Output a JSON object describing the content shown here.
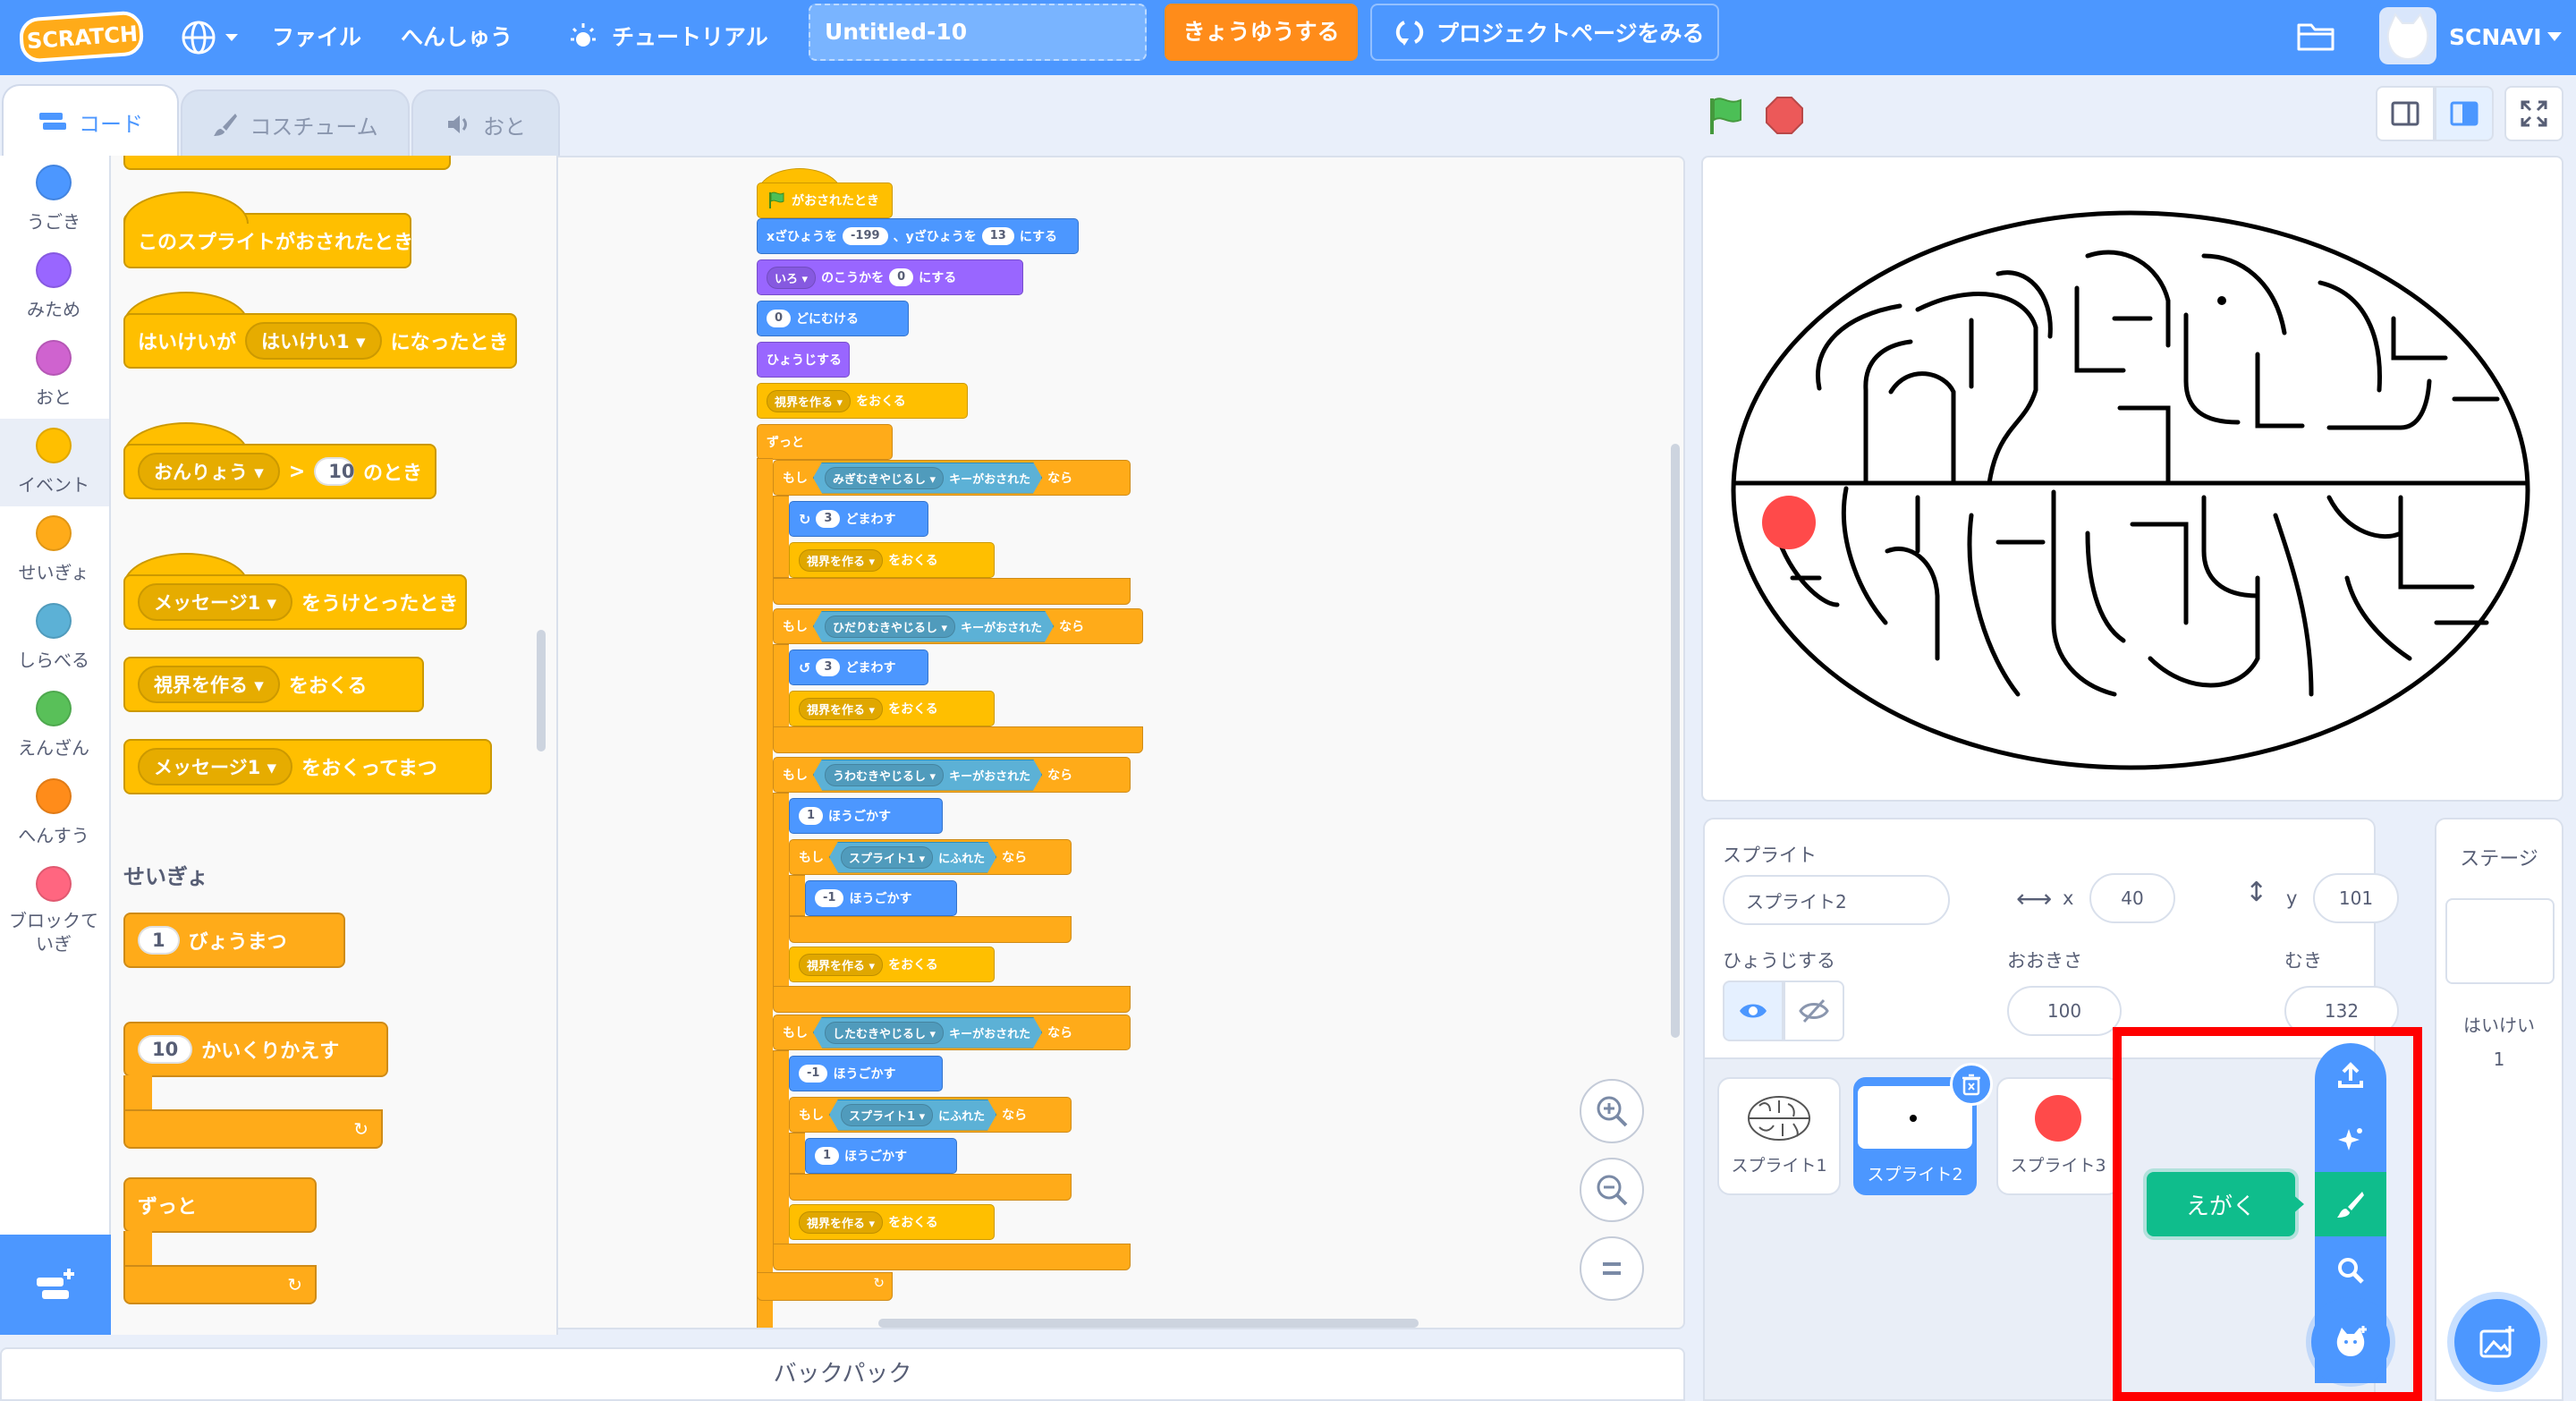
{
  "menu": {
    "logo": "SCRATCH",
    "file": "ファイル",
    "edit": "へんしゅう",
    "tutorial": "チュートリアル",
    "project_title": "Untitled-10",
    "share": "きょうゆうする",
    "see_project_page": "プロジェクトページをみる",
    "username": "SCNAVI"
  },
  "tabs": {
    "code": "コード",
    "costume": "コスチューム",
    "sound": "おと"
  },
  "categories": [
    {
      "label": "うごき",
      "color": "#4c97ff"
    },
    {
      "label": "みため",
      "color": "#9966ff"
    },
    {
      "label": "おと",
      "color": "#cf63cf"
    },
    {
      "label": "イベント",
      "color": "#ffbf00"
    },
    {
      "label": "せいぎょ",
      "color": "#ffab19"
    },
    {
      "label": "しらべる",
      "color": "#5cb1d6"
    },
    {
      "label": "えんざん",
      "color": "#59c059"
    },
    {
      "label": "へんすう",
      "color": "#ff8c1a"
    },
    {
      "label": "ブロックていぎ",
      "color": "#ff6680"
    }
  ],
  "palette": {
    "when_sprite_clicked": "このスプライトがおされたとき",
    "when_backdrop_a": "はいけいが",
    "backdrop_name": "はいけい1",
    "when_backdrop_b": "になったとき",
    "loudness": "おんりょう",
    "gt": ">",
    "loudness_value": "10",
    "when_gt_end": "のとき",
    "message1": "メッセージ1",
    "when_receive": "をうけとったとき",
    "view_make": "視界を作る",
    "broadcast": "をおくる",
    "broadcast_wait": "をおくってまつ",
    "control_heading": "せいぎょ",
    "wait_value": "1",
    "wait_label": "びょうまつ",
    "repeat_value": "10",
    "repeat_label": "かいくりかえす",
    "forever_label": "ずっと"
  },
  "script": {
    "flag_clicked": "がおされたとき",
    "goto_x_label": "xざひょうを",
    "goto_x": "-199",
    "goto_y_label": "、yざひょうを",
    "goto_y": "13",
    "goto_suffix": "にする",
    "effect_name": "いろ",
    "effect_label": "のこうかを",
    "effect_value": "0",
    "effect_suffix": "にする",
    "direction_value": "0",
    "direction_label": "どにむける",
    "show": "ひょうじする",
    "view_make": "視界を作る",
    "send": "をおくる",
    "forever": "ずっと",
    "if": "もし",
    "then": "なら",
    "key_pressed": "キーがおされた",
    "key_right": "みぎむきやじるし",
    "key_left": "ひだりむきやじるし",
    "key_up": "うわむきやじるし",
    "key_down": "したむきやじるし",
    "turn_value": "3",
    "turn_label": "どまわす",
    "move_label": "ほうごかす",
    "move_1": "1",
    "move_neg1": "-1",
    "touching_target": "スプライト1",
    "touching_label": "にふれた"
  },
  "backpack": "バックパック",
  "sprite_info": {
    "sprite_label": "スプライト",
    "sprite_name": "スプライト2",
    "x_label": "x",
    "x": "40",
    "y_label": "y",
    "y": "101",
    "show_label": "ひょうじする",
    "size_label": "おおきさ",
    "size": "100",
    "direction_label": "むき",
    "direction": "132"
  },
  "sprites": [
    {
      "name": "スプライト1"
    },
    {
      "name": "スプライト2"
    },
    {
      "name": "スプライト3"
    }
  ],
  "stage_panel": {
    "title": "ステージ",
    "backdrops_label": "はいけい",
    "backdrops_count": "1"
  },
  "popup_tooltip": "えがく",
  "accent": {
    "menu_blue": "#4c97ff",
    "share_orange": "#ff8c1a",
    "highlight_red": "#ff0000",
    "paint_green": "#0fbd8c"
  }
}
